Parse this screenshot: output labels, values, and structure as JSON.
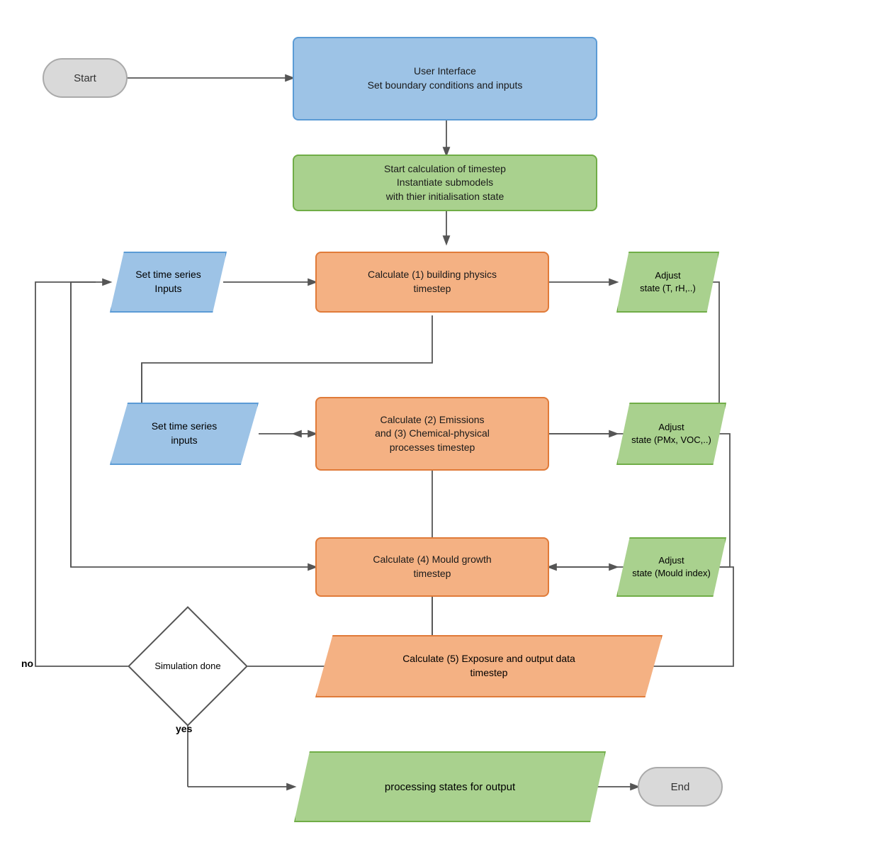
{
  "nodes": {
    "start": {
      "label": "Start"
    },
    "user_interface": {
      "label": "User Interface\nSet boundary conditions and inputs"
    },
    "instantiate": {
      "label": "Start calculation of timestep\nInstantiate submodels\nwith thier initialisation state"
    },
    "set_time_series_1": {
      "label": "Set time series\nInputs"
    },
    "calc_building": {
      "label": "Calculate (1) building physics\ntimestep"
    },
    "adjust_T": {
      "label": "Adjust\nstate (T, rH,..)"
    },
    "set_time_series_2": {
      "label": "Set time series\ninputs"
    },
    "calc_emissions": {
      "label": "Calculate (2) Emissions\nand (3) Chemical-physical\nprocesses timestep"
    },
    "adjust_PMx": {
      "label": "Adjust\nstate (PMx, VOC,..)"
    },
    "calc_mould": {
      "label": "Calculate (4) Mould growth\ntimestep"
    },
    "adjust_mould": {
      "label": "Adjust\nstate (Mould index)"
    },
    "calc_exposure": {
      "label": "Calculate (5) Exposure and output data\ntimestep"
    },
    "simulation_done": {
      "label": "Simulation\ndone"
    },
    "processing": {
      "label": "processing states for output"
    },
    "end": {
      "label": "End"
    },
    "no_label": {
      "label": "no"
    },
    "yes_label": {
      "label": "yes"
    }
  }
}
